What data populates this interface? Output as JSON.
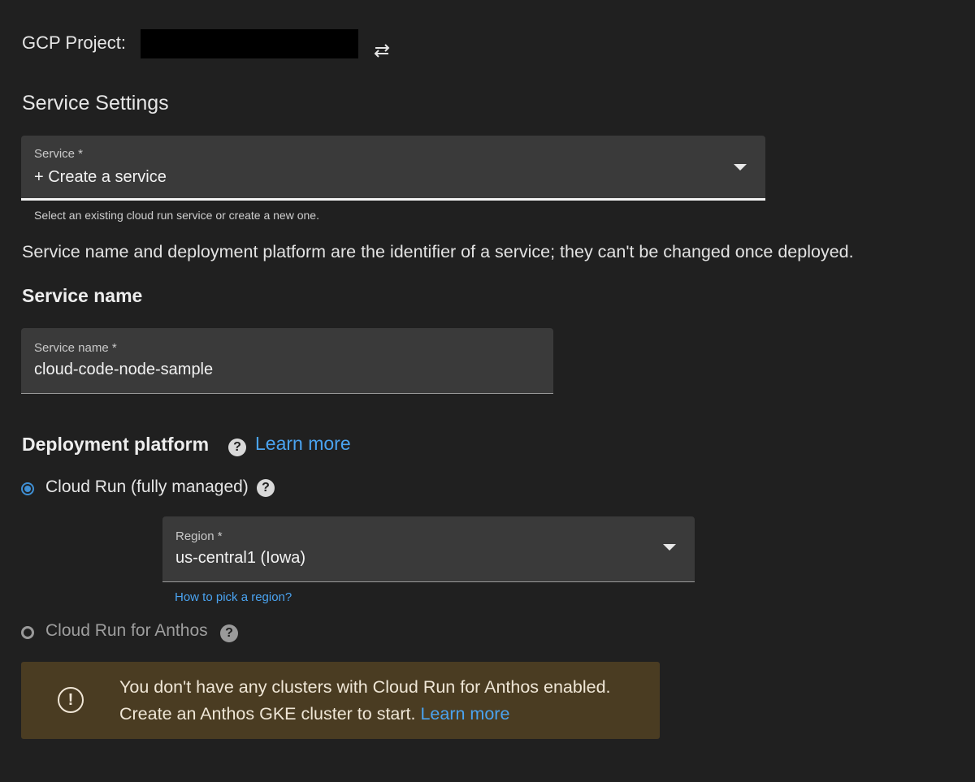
{
  "project": {
    "label": "GCP Project:"
  },
  "settings": {
    "title": "Service Settings",
    "service_field": {
      "label": "Service *",
      "value": "+ Create a service",
      "helper": "Select an existing cloud run service or create a new one."
    },
    "info": "Service name and deployment platform are the identifier of a service; they can't be changed once deployed."
  },
  "service_name": {
    "heading": "Service name",
    "field_label": "Service name *",
    "field_value": "cloud-code-node-sample"
  },
  "deployment": {
    "heading": "Deployment platform",
    "learn_more": "Learn more",
    "options": [
      {
        "label": "Cloud Run (fully managed)",
        "selected": true
      },
      {
        "label": "Cloud Run for Anthos",
        "selected": false
      }
    ],
    "region": {
      "label": "Region *",
      "value": "us-central1 (Iowa)",
      "link": "How to pick a region?"
    },
    "warning": {
      "text": "You don't have any clusters with Cloud Run for Anthos enabled. Create an Anthos GKE cluster to start.",
      "link": "Learn more"
    }
  },
  "colors": {
    "background": "#202020",
    "field_bg": "#3a3a3a",
    "link": "#4aa3f0",
    "radio_selected": "#3f8fd4",
    "warning_bg": "#4a3c22"
  },
  "icons": [
    "swap-icon",
    "help-icon",
    "warning-icon",
    "dropdown-caret-icon"
  ]
}
